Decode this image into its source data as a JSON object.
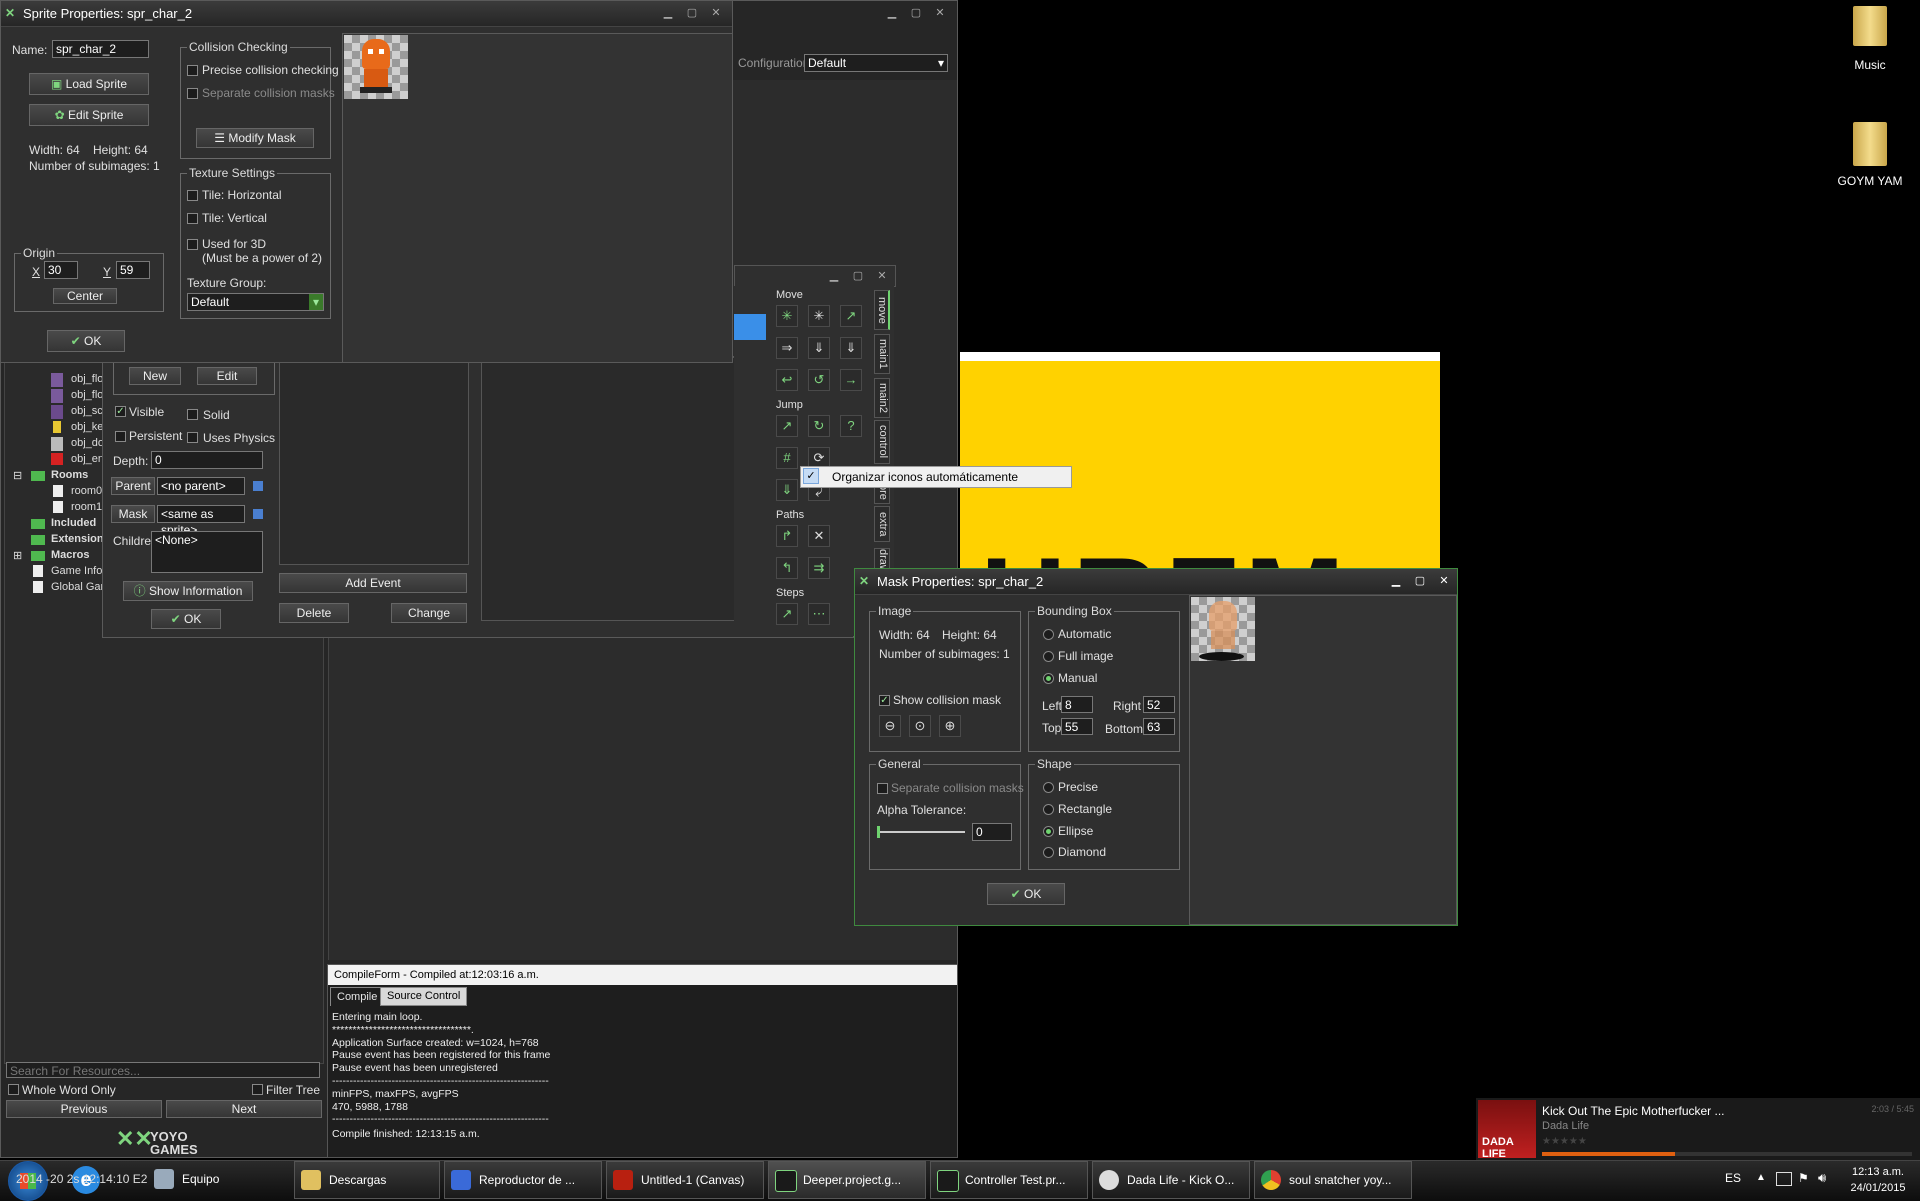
{
  "desktop": {
    "icons": [
      {
        "label": "Music",
        "icon": "folder-icon"
      },
      {
        "label": "GOYM YAM",
        "icon": "folder-icon"
      }
    ],
    "banner_text": "HRFM",
    "banner_color": "#ffd200"
  },
  "ide": {
    "config_label": "Configuration:",
    "config_value": "Default",
    "tree": {
      "items": [
        "obj_flo",
        "obj_flo",
        "obj_sc",
        "obj_ke",
        "obj_do",
        "obj_en"
      ],
      "rooms": "Rooms",
      "room_items": [
        "room0",
        "room1"
      ],
      "included": "Included",
      "extensions": "Extension",
      "macros": "Macros",
      "game_info": "Game Info",
      "global_game": "Global Gar"
    },
    "search_placeholder": "Search For Resources...",
    "whole_word": "Whole Word Only",
    "filter_tree": "Filter Tree",
    "previous": "Previous",
    "next": "Next",
    "logo_text": "YOYO GAMES",
    "overlap_text": "2014 -20 2s 12:14:10 E2"
  },
  "object_props": {
    "new": "New",
    "edit": "Edit",
    "visible": "Visible",
    "solid": "Solid",
    "persistent": "Persistent",
    "uses_physics": "Uses Physics",
    "depth_label": "Depth:",
    "depth_value": "0",
    "parent_label": "Parent",
    "parent_value": "<no parent>",
    "mask_label": "Mask",
    "mask_value": "<same as sprite>",
    "children_label": "Children:",
    "children_value": "<None>",
    "show_info": "Show Information",
    "ok": "OK",
    "add_event": "Add Event",
    "delete": "Delete",
    "change": "Change"
  },
  "actions": {
    "sections": [
      "Move",
      "Jump",
      "Paths",
      "Steps"
    ],
    "tabs": [
      "move",
      "main1",
      "main2",
      "control",
      "score",
      "extra",
      "draw"
    ]
  },
  "context_menu": {
    "item": "Organizar iconos automáticamente"
  },
  "sprite_window": {
    "title": "Sprite Properties: spr_char_2",
    "name_label": "Name:",
    "name_value": "spr_char_2",
    "load_sprite": "Load Sprite",
    "edit_sprite": "Edit Sprite",
    "width_text": "Width: 64",
    "height_text": "Height: 64",
    "subimages_text": "Number of subimages: 1",
    "origin_title": "Origin",
    "origin_x_label": "X",
    "origin_x": "30",
    "origin_y_label": "Y",
    "origin_y": "59",
    "center": "Center",
    "ok": "OK",
    "collision_title": "Collision Checking",
    "precise": "Precise collision checking",
    "separate": "Separate collision masks",
    "modify_mask": "Modify Mask",
    "texture_title": "Texture Settings",
    "tile_h": "Tile: Horizontal",
    "tile_v": "Tile: Vertical",
    "used_3d": "Used for 3D",
    "power2": "(Must be a power of 2)",
    "texture_group_label": "Texture Group:",
    "texture_group_value": "Default"
  },
  "mask_window": {
    "title": "Mask Properties: spr_char_2",
    "image_title": "Image",
    "width_text": "Width: 64",
    "height_text": "Height: 64",
    "subimages_text": "Number of subimages: 1",
    "show_mask": "Show collision mask",
    "bbox_title": "Bounding Box",
    "automatic": "Automatic",
    "full_image": "Full image",
    "manual": "Manual",
    "left_label": "Left",
    "left_value": "8",
    "right_label": "Right",
    "right_value": "52",
    "top_label": "Top",
    "top_value": "55",
    "bottom_label": "Bottom",
    "bottom_value": "63",
    "general_title": "General",
    "separate": "Separate collision masks",
    "alpha_label": "Alpha Tolerance:",
    "alpha_value": "0",
    "shape_title": "Shape",
    "precise": "Precise",
    "rectangle": "Rectangle",
    "ellipse": "Ellipse",
    "diamond": "Diamond",
    "ok": "OK"
  },
  "compile": {
    "header": "CompileForm - Compiled at:12:03:16 a.m.",
    "tabs": [
      "Compile",
      "Source Control"
    ],
    "lines": [
      "Entering main loop.",
      "**********************************.",
      "Application Surface created: w=1024, h=768",
      "Pause event has been registered for this frame",
      "Pause event has been unregistered",
      "--------------------------------------------------------------",
      "minFPS, maxFPS, avgFPS",
      "470, 5988, 1788",
      "--------------------------------------------------------------",
      "Compile finished: 12:13:15 a.m."
    ]
  },
  "media": {
    "title": "Kick Out The Epic Motherfucker ...",
    "artist": "Dada Life",
    "time": "2:03 / 5:45",
    "progress": 0.36,
    "album_text": "DADA LIFE"
  },
  "taskbar": {
    "tasks": [
      "Equipo",
      "Descargas",
      "Reproductor de ...",
      "Untitled-1 (Canvas)",
      "Deeper.project.g...",
      "Controller Test.pr...",
      "Dada Life - Kick O...",
      "soul snatcher yoy..."
    ],
    "lang": "ES",
    "time": "12:13 a.m.",
    "date": "24/01/2015"
  }
}
